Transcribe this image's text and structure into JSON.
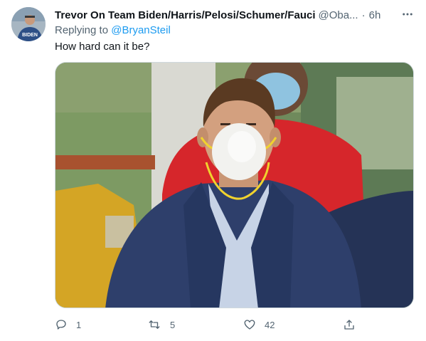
{
  "tweet": {
    "author_name": "Trevor On Team Biden/Harris/Pelosi/Schumer/Fauci",
    "author_handle": "@Oba...",
    "separator": "·",
    "time": "6h",
    "replying_prefix": "Replying to",
    "replying_to": "@BryanSteil",
    "text": "How hard can it be?",
    "avatar_text": "BIDEN",
    "stats": {
      "replies": "1",
      "retweets": "5",
      "likes": "42"
    }
  },
  "icons": {
    "more": "more-horizontal-icon",
    "reply": "reply-icon",
    "retweet": "retweet-icon",
    "like": "heart-icon",
    "share": "share-icon"
  },
  "colors": {
    "accent": "#1d9bf0",
    "secondary_text": "#536471",
    "primary_text": "#0f1419",
    "border": "#cfd9de"
  }
}
